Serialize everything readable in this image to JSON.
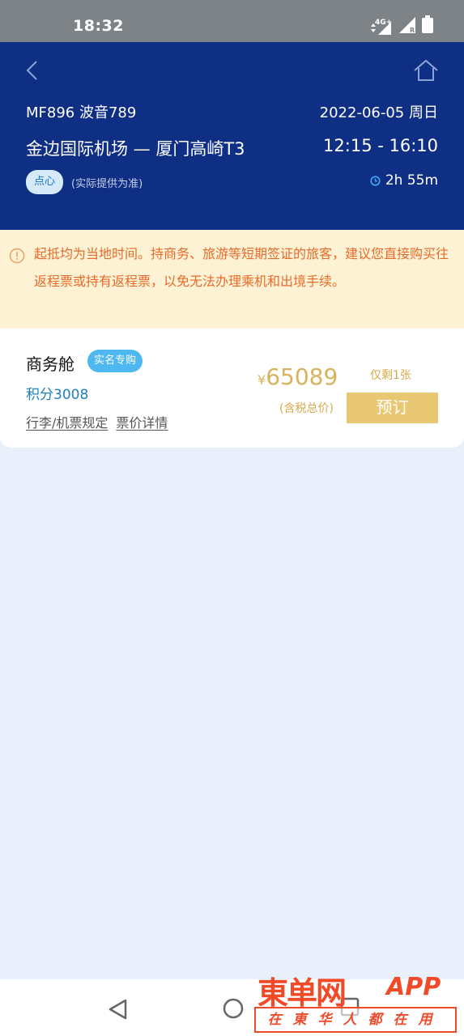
{
  "status_bar": {
    "time": "18:32",
    "network": "4G+"
  },
  "header": {
    "flight_no": "MF896 波音789",
    "date": "2022-06-05 周日",
    "route": "金边国际机场 — 厦门高崎T3",
    "times": "12:15 - 16:10",
    "meal": "点心",
    "meal_note": "(实际提供为准)",
    "duration": "2h 55m"
  },
  "notice": {
    "text": "起抵均为当地时间。持商务、旅游等短期签证的旅客，建议您直接购买往返程票或持有返程票，以免无法办理乘机和出境手续。"
  },
  "fare": {
    "cabin": "商务舱",
    "badge": "实名专购",
    "points": "积分3008",
    "baggage_link": "行李/机票规定",
    "price_detail_link": "票价详情",
    "currency": "¥",
    "price": "65089",
    "tax_note": "(含税总价)",
    "remaining": "仅剩1张",
    "book_label": "预订"
  },
  "watermark": {
    "brand": "東单网",
    "app": "APP",
    "slogan": "在東华人都在用"
  },
  "colors": {
    "header_bg": "#0f2f85",
    "notice_bg": "#fdf2d3",
    "notice_text": "#e86a2b",
    "price": "#d9b25c",
    "book_button": "#e9c873",
    "page_bg": "#eaf0fb"
  }
}
